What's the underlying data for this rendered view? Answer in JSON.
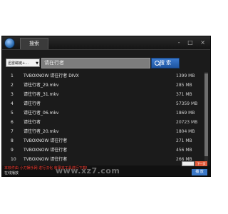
{
  "window": {
    "tab_label": "搜索",
    "controls": "- □ ×"
  },
  "search": {
    "source_select": "迅雷磁链+…",
    "placeholder": "请在行者",
    "button_label": "搜 索"
  },
  "results": [
    {
      "n": "1",
      "name": "TVBOXNOW 请往行者 DIVX",
      "size": "1399 MB"
    },
    {
      "n": "2",
      "name": "请往行者_29.mkv",
      "size": "285 MB"
    },
    {
      "n": "3",
      "name": "请往行者_31.mkv",
      "size": "371 MB"
    },
    {
      "n": "4",
      "name": "请往行者",
      "size": "57359 MB"
    },
    {
      "n": "5",
      "name": "请往行者_06.mkv",
      "size": "1869 MB"
    },
    {
      "n": "6",
      "name": "请往行者",
      "size": "20723 MB"
    },
    {
      "n": "7",
      "name": "请往行者_20.mkv",
      "size": "1804 MB"
    },
    {
      "n": "8",
      "name": "TVBOXNOW 请往行者",
      "size": "271 MB"
    },
    {
      "n": "9",
      "name": "TVBOXNOW 请往行者",
      "size": "456 MB"
    },
    {
      "n": "10",
      "name": "TVBOXNOW 请往行者",
      "size": "266 MB"
    }
  ],
  "status": {
    "watermark_text": "本软件由 小刀娱乐网 进行汉化 收录本工具进行下载!",
    "next_label": "下一页",
    "bottom_left": "在线播放",
    "bottom_button": "播 放"
  },
  "site": "www.xz7.com",
  "colors": {
    "window_bg": "#1b1b1b",
    "accent_blue": "#2a64b4",
    "watermark_red": "#ff3b2f"
  }
}
